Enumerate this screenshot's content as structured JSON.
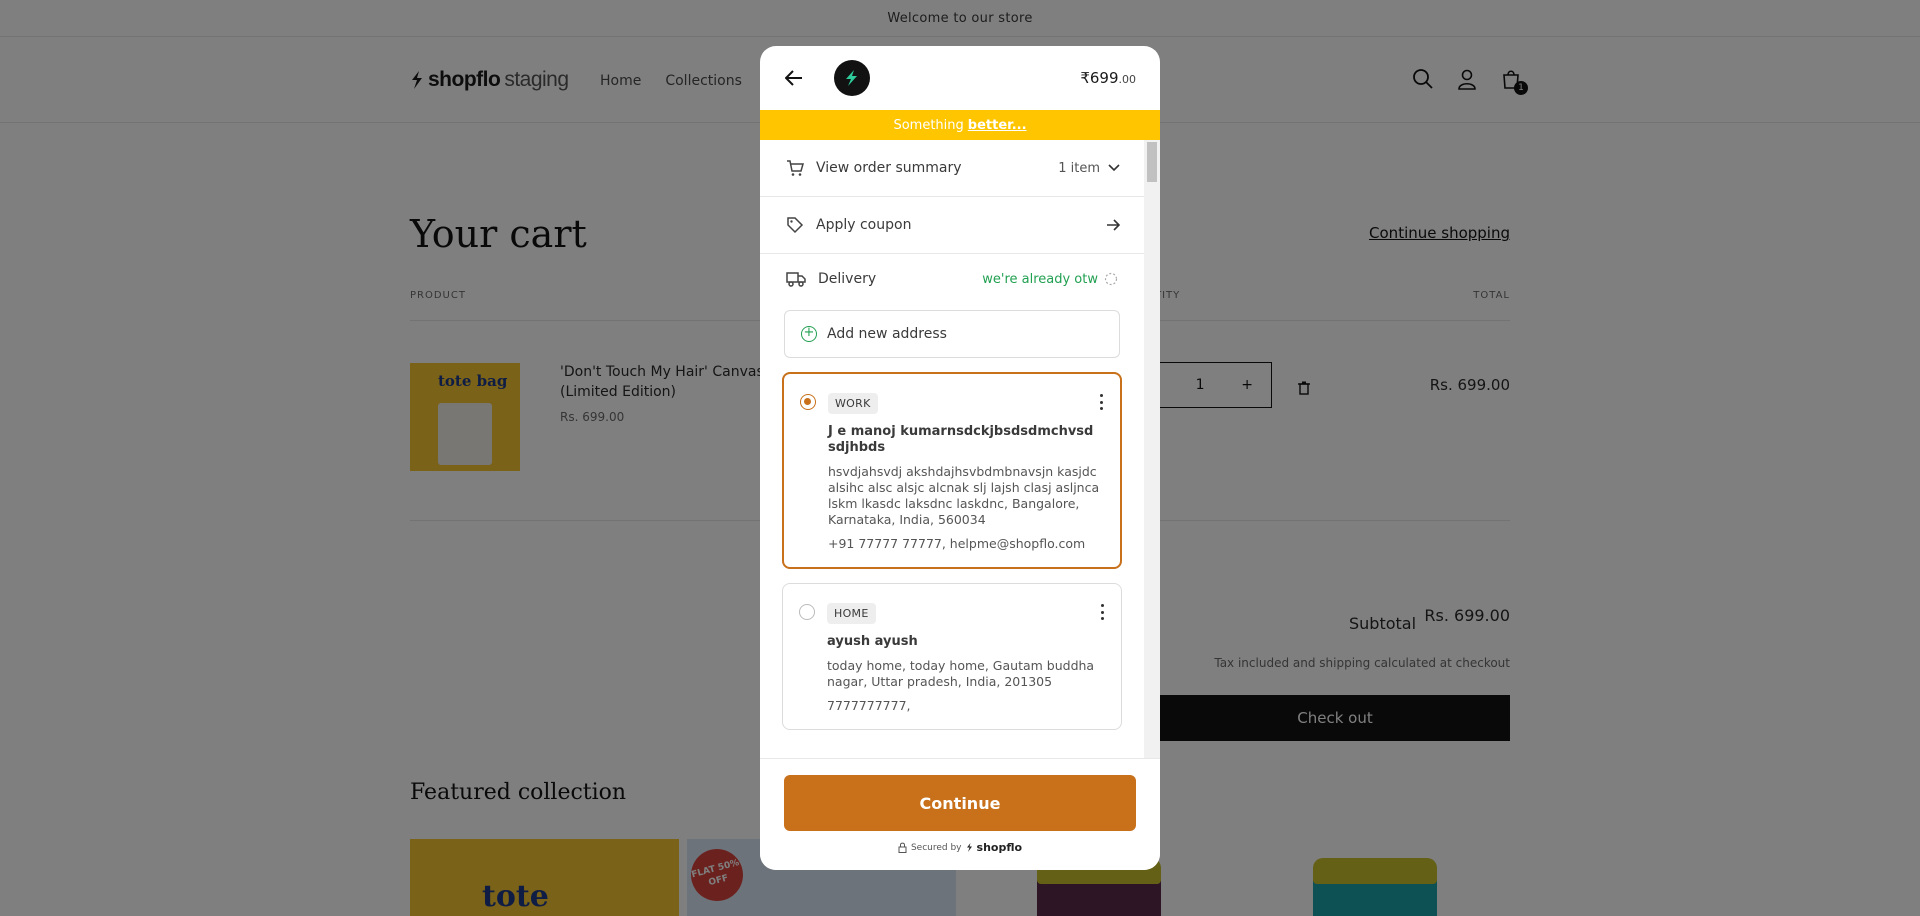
{
  "store": {
    "announcement": "Welcome to our store",
    "logo_bold": "shopflo",
    "logo_light": "staging",
    "nav": [
      "Home",
      "Collections",
      "C"
    ],
    "cart_count": "1",
    "cart_title": "Your cart",
    "continue_shopping": "Continue shopping",
    "col_product": "PRODUCT",
    "col_quantity": "TITY",
    "col_total": "TOTAL",
    "product_name": "'Don't Touch My Hair' Canvas (Limited Edition)",
    "product_price": "Rs. 699.00",
    "product_image_text": "tote bag",
    "quantity": "1",
    "qty_minus": "",
    "qty_plus": "+",
    "line_total": "Rs. 699.00",
    "subtotal_label": "Subtotal",
    "subtotal_value": "Rs. 699.00",
    "tax_note": "Tax included and shipping calculated at checkout",
    "checkout": "Check out",
    "featured": "Featured collection",
    "featured_card1_text": "tote",
    "featured_card2_badge": "FLAT 50% OFF"
  },
  "modal": {
    "price_main": "₹699",
    "price_decimal": ".00",
    "banner_text": "Something",
    "banner_link": "better...",
    "order_summary_label": "View order summary",
    "order_summary_count": "1 item",
    "coupon_label": "Apply coupon",
    "delivery_label": "Delivery",
    "delivery_status": "we're already otw",
    "add_address": "Add new address",
    "addresses": [
      {
        "tag": "WORK",
        "name": "J e manoj kumarnsdckjbsdsdmchvsd sdjhbds",
        "address": "hsvdjahsvdj akshdajhsvbdmbnavsjn kasjdc alsihc alsc alsjc alcnak slj lajsh clasj asljnca lskm lkasdc laksdnc laskdnc, Bangalore, Karnataka, India, 560034",
        "contact": "+91 77777 77777, helpme@shopflo.com",
        "selected": true
      },
      {
        "tag": "HOME",
        "name": "ayush ayush",
        "address": "today home, today home, Gautam buddha nagar, Uttar pradesh, India, 201305",
        "contact": "7777777777,",
        "selected": false
      }
    ],
    "continue": "Continue",
    "secured_by": "Secured by",
    "secured_brand": "shopflo"
  },
  "colors": {
    "accent": "#c8701a",
    "banner": "#ffc600",
    "success": "#22a052"
  }
}
